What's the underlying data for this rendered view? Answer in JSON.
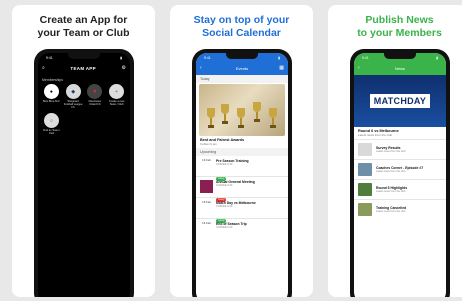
{
  "cards": [
    {
      "caption_line1": "Create an App for",
      "caption_line2": "your Team or Club",
      "caption_color": "#222222",
      "status_time": "9:41",
      "app_logo": "TEAM APP",
      "section_label": "Memberships",
      "members": [
        {
          "label": "Bow Bros AFC"
        },
        {
          "label": "Sheppard Football League FC"
        },
        {
          "label": "Mountview United FC"
        },
        {
          "label": "Create a new Team / Club"
        }
      ],
      "find_label": "Find an Team / Club"
    },
    {
      "caption_line1": "Stay on top of your",
      "caption_line2": "Social Calendar",
      "caption_color": "#1f6fd6",
      "status_time": "9:41",
      "app_title": "Events",
      "today_label": "Today",
      "featured_title": "Best and Fairest Awards",
      "featured_sub": "Coffee hi am",
      "upcoming_label": "Upcoming",
      "events": [
        {
          "date": "13 Feb",
          "name": "Pre Season Training",
          "meta": "COFFEE 6:30",
          "tag": "Going"
        },
        {
          "date": "14 Feb",
          "name": "Annual General Meeting",
          "meta": "COFFEE 6:30",
          "tag": "Going"
        },
        {
          "date": "15 Feb",
          "name": "Match Day vs Melbourne",
          "meta": "COFFEE 6:30",
          "tag": "Going"
        },
        {
          "date": "16 Feb",
          "name": "End of Season Trip",
          "meta": "COFFEE 6:30",
          "tag": ""
        }
      ]
    },
    {
      "caption_line1": "Publish News",
      "caption_line2": "to your Members",
      "caption_color": "#3ab34a",
      "status_time": "9:41",
      "app_title": "News",
      "banner_text": "MATCHDAY",
      "featured_title": "Round 6 vs Melbourne",
      "featured_sub": "Latest news from the club",
      "news": [
        {
          "name": "Survey Results",
          "meta": "Latest news from the club"
        },
        {
          "name": "Coaches Corner - Episode #7",
          "meta": "Latest news from the club"
        },
        {
          "name": "Round 5 Highlights",
          "meta": "Latest news from the club"
        },
        {
          "name": "Training Cancelled",
          "meta": "Latest news from the club"
        }
      ]
    }
  ]
}
